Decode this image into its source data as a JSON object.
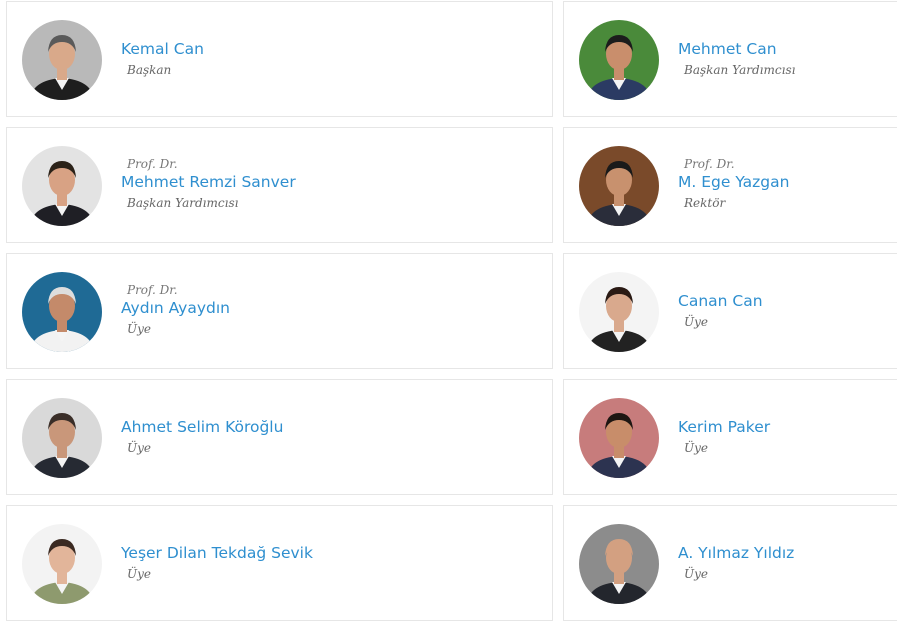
{
  "members": [
    {
      "prefix": "",
      "name": "Kemal Can",
      "role": "Başkan",
      "bg": "#b9b9b9",
      "skin": "#d9a98a",
      "hair": "#5a5a5a",
      "suit": "#1e1e1e"
    },
    {
      "prefix": "",
      "name": "Mehmet Can",
      "role": "Başkan Yardımcısı",
      "bg": "#4a8a3a",
      "skin": "#c98e6c",
      "hair": "#1c1c1c",
      "suit": "#2b3b63"
    },
    {
      "prefix": "Prof. Dr.",
      "name": "Mehmet Remzi Sanver",
      "role": "Başkan Yardımcısı",
      "bg": "#e3e3e3",
      "skin": "#d8a284",
      "hair": "#2b2218",
      "suit": "#1f1f25"
    },
    {
      "prefix": "Prof. Dr.",
      "name": "M. Ege Yazgan",
      "role": "Rektör",
      "bg": "#7a4a2a",
      "skin": "#c8916e",
      "hair": "#1a1a1a",
      "suit": "#2a2d3a"
    },
    {
      "prefix": "Prof. Dr.",
      "name": "Aydın Ayaydın",
      "role": "Üye",
      "bg": "#1f6a95",
      "skin": "#c48a6a",
      "hair": "#dddddd",
      "suit": "#f2f2f2"
    },
    {
      "prefix": "",
      "name": "Canan Can",
      "role": "Üye",
      "bg": "#f4f4f4",
      "skin": "#d9a98d",
      "hair": "#2a1a14",
      "suit": "#222222"
    },
    {
      "prefix": "",
      "name": "Ahmet Selim Köroğlu",
      "role": "Üye",
      "bg": "#d9d9d9",
      "skin": "#c9977a",
      "hair": "#3a2e28",
      "suit": "#262a33"
    },
    {
      "prefix": "",
      "name": "Kerim Paker",
      "role": "Üye",
      "bg": "#c77c7c",
      "skin": "#c88d6a",
      "hair": "#1e1612",
      "suit": "#2c3350"
    },
    {
      "prefix": "",
      "name": "Yeşer Dilan Tekdağ Sevik",
      "role": "Üye",
      "bg": "#f3f3f3",
      "skin": "#e2b59a",
      "hair": "#3b2a22",
      "suit": "#8e9a6e"
    },
    {
      "prefix": "",
      "name": "A. Yılmaz Yıldız",
      "role": "Üye",
      "bg": "#8c8c8c",
      "skin": "#d3a081",
      "hair": "#d3a081",
      "suit": "#23262d"
    }
  ]
}
